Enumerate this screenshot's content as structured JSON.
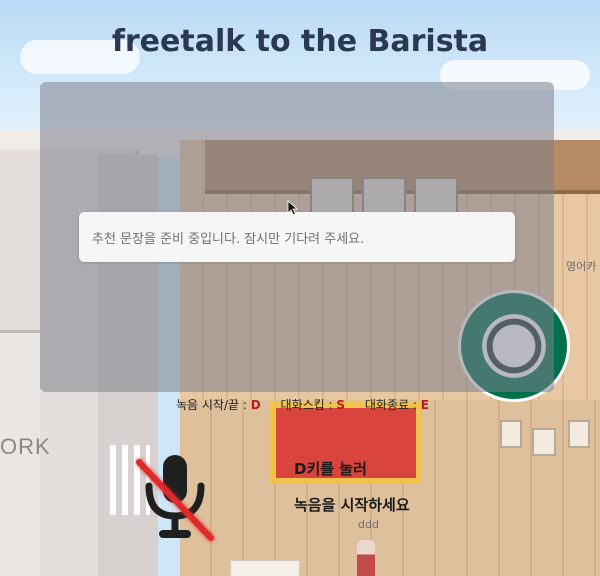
{
  "title": "freetalk to the Barista",
  "status_message": "추천 문장을 준비 중입니다. 잠시만 기다려 주세요.",
  "shortcuts": [
    {
      "label": "녹음 시작/끝",
      "key": "D"
    },
    {
      "label": "대화스킵",
      "key": "S"
    },
    {
      "label": "대화종료",
      "key": "E"
    }
  ],
  "hint": {
    "line1": "D키를 눌러",
    "line2": "녹음을 시작하세요"
  },
  "scene": {
    "left_sign": "ORK",
    "right_label": "영어카",
    "character_name": "ddd"
  },
  "mic": {
    "icon": "microphone-muted-icon",
    "state": "off"
  },
  "colors": {
    "title": "#2a3850",
    "shortcut_key": "#c0191f",
    "mic_slash": "#e02b2b",
    "overlay": "rgba(125,128,140,0.55)"
  }
}
